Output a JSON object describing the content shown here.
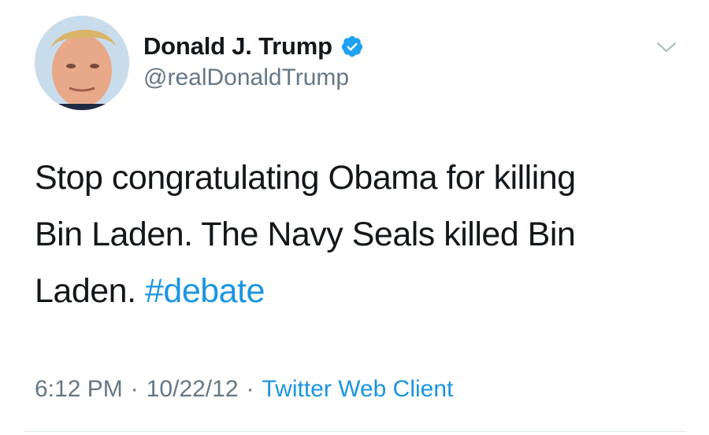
{
  "tweet": {
    "author": {
      "display_name": "Donald J. Trump",
      "handle": "@realDonaldTrump",
      "verified_icon": "verified-badge-icon"
    },
    "menu_icon": "chevron-down-icon",
    "text_line_1": "Stop congratulating Obama for killing",
    "text_line_2": "Bin Laden. The Navy Seals killed Bin",
    "text_line_3": "Laden.",
    "hashtag": "#debate",
    "time": "6:12 PM",
    "separator": "·",
    "date": "10/22/12",
    "client": "Twitter Web Client"
  },
  "colors": {
    "link": "#1b95e0",
    "secondary": "#657786",
    "primary": "#14171a"
  }
}
